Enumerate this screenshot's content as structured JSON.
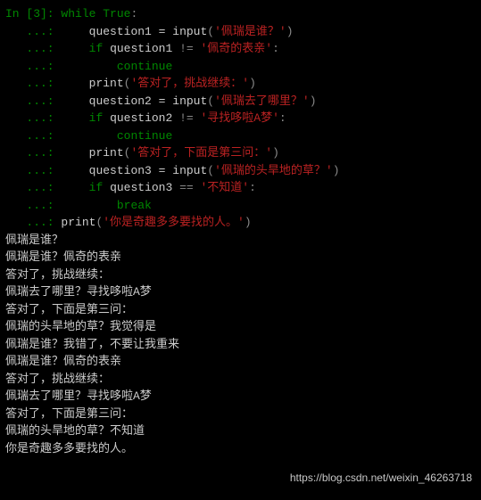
{
  "cell_prompt": "In [3]: ",
  "cont_prompt": "   ...: ",
  "code": {
    "while_kw": "while",
    "true_v": "True",
    "colon": ":",
    "q1_id": "question1",
    "q2_id": "question2",
    "q3_id": "question3",
    "assign": " = ",
    "input_fn": "input",
    "lparen": "(",
    "rparen": ")",
    "q1_prompt": "'佩瑞是谁？'",
    "if_kw": "if",
    "ne": " != ",
    "eqeq": " == ",
    "q1_ans": "'佩奇的表亲'",
    "continue_kw": "continue",
    "print_fn": "print",
    "p1_msg": "'答对了，挑战继续：'",
    "q2_prompt": "'佩瑞去了哪里？'",
    "q2_ans": "'寻找哆啦A梦'",
    "p2_msg": "'答对了，下面是第三问：'",
    "q3_prompt": "'佩瑞的头旱地的草？'",
    "q3_ans": "'不知道'",
    "break_kw": "break",
    "final_msg": "'你是奇趣多多要找的人。'"
  },
  "output": [
    "佩瑞是谁？",
    "佩瑞是谁？佩奇的表亲",
    "答对了，挑战继续：",
    "佩瑞去了哪里？寻找哆啦A梦",
    "答对了，下面是第三问：",
    "佩瑞的头旱地的草？我觉得是",
    "佩瑞是谁？我错了，不要让我重来",
    "佩瑞是谁？佩奇的表亲",
    "答对了，挑战继续：",
    "佩瑞去了哪里？寻找哆啦A梦",
    "答对了，下面是第三问：",
    "佩瑞的头旱地的草？不知道",
    "你是奇趣多多要找的人。"
  ],
  "watermark": "https://blog.csdn.net/weixin_46263718"
}
